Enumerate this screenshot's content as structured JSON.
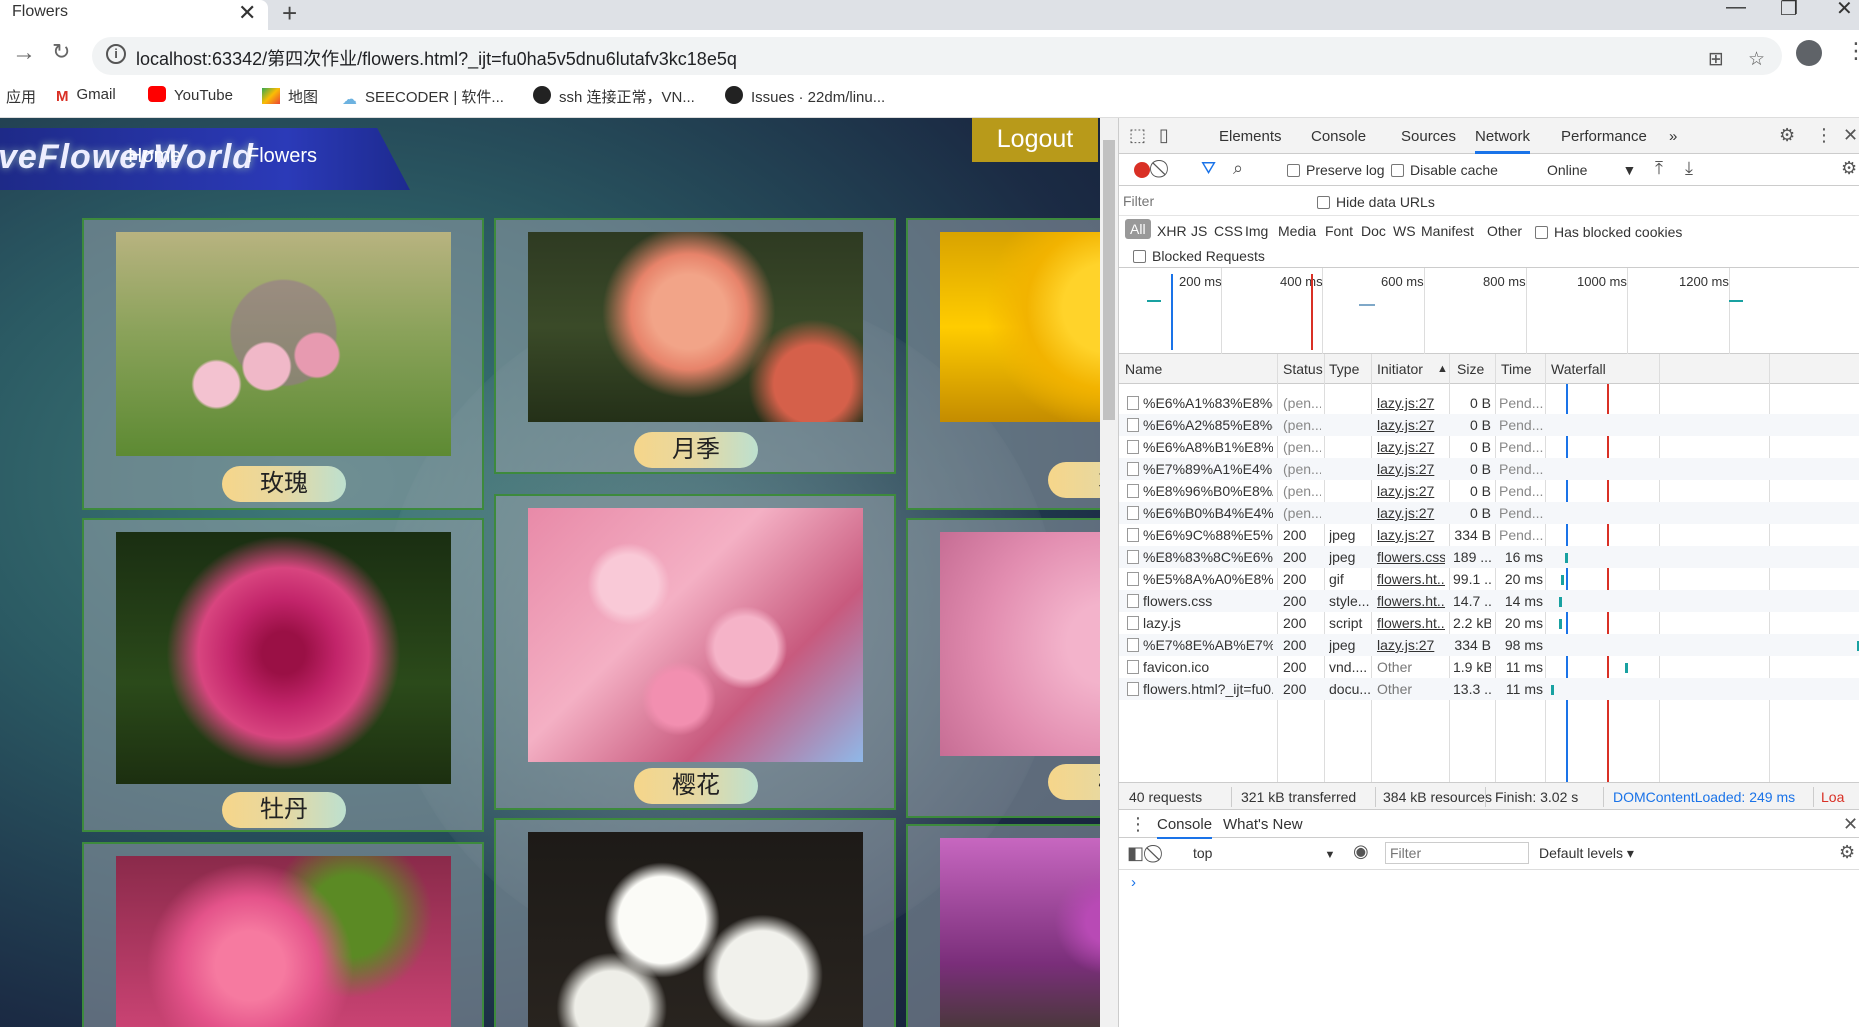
{
  "browser": {
    "tab_title": "Flowers",
    "tab_close": "✕",
    "new_tab": "+",
    "url_prefix": "localhost",
    "url": "localhost:63342/第四次作业/flowers.html?_ijt=fu0ha5v5dnu6lutafv3kc18e5q",
    "window_controls": [
      "—",
      "❐",
      "✕"
    ]
  },
  "bookmarks": [
    {
      "label": "应用",
      "icon": "apps-icon"
    },
    {
      "label": "Gmail",
      "icon": "gmail-icon"
    },
    {
      "label": "YouTube",
      "icon": "youtube-icon"
    },
    {
      "label": "地图",
      "icon": "maps-icon"
    },
    {
      "label": "SEECODER | 软件...",
      "icon": "seecoder-icon"
    },
    {
      "label": "ssh 连接正常，VN...",
      "icon": "github-icon"
    },
    {
      "label": "Issues · 22dm/linu...",
      "icon": "github-icon"
    }
  ],
  "page": {
    "logo": "veFlowerWorld",
    "nav_home": "Home",
    "nav_flowers": "Flowers",
    "logout": "Logout",
    "flowers": [
      "玫瑰",
      "月季",
      "水",
      "牡丹",
      "樱花",
      "梅"
    ]
  },
  "devtools": {
    "tabs": [
      "Elements",
      "Console",
      "Sources",
      "Network",
      "Performance",
      "»"
    ],
    "preserve_log": "Preserve log",
    "disable_cache": "Disable cache",
    "throttle": "Online",
    "filter_placeholder": "Filter",
    "hide_data_urls": "Hide data URLs",
    "types": [
      "All",
      "XHR",
      "JS",
      "CSS",
      "Img",
      "Media",
      "Font",
      "Doc",
      "WS",
      "Manifest",
      "Other"
    ],
    "has_blocked_cookies": "Has blocked cookies",
    "blocked_requests": "Blocked Requests",
    "timeline_labels": [
      "200 ms",
      "400 ms",
      "600 ms",
      "800 ms",
      "1000 ms",
      "1200 ms"
    ],
    "columns": [
      "Name",
      "Status",
      "Type",
      "Initiator",
      "Size",
      "Time",
      "Waterfall"
    ],
    "rows": [
      {
        "name": "%E6%A1%83%E8%8...",
        "status": "(pen...",
        "type": "",
        "initiator": "lazy.js:27",
        "size": "0 B",
        "time": "Pend..."
      },
      {
        "name": "%E6%A2%85%E8%8...",
        "status": "(pen...",
        "type": "",
        "initiator": "lazy.js:27",
        "size": "0 B",
        "time": "Pend..."
      },
      {
        "name": "%E6%A8%B1%E8%8...",
        "status": "(pen...",
        "type": "",
        "initiator": "lazy.js:27",
        "size": "0 B",
        "time": "Pend..."
      },
      {
        "name": "%E7%89%A1%E4%B...",
        "status": "(pen...",
        "type": "",
        "initiator": "lazy.js:27",
        "size": "0 B",
        "time": "Pend..."
      },
      {
        "name": "%E8%96%B0%E8%A...",
        "status": "(pen...",
        "type": "",
        "initiator": "lazy.js:27",
        "size": "0 B",
        "time": "Pend..."
      },
      {
        "name": "%E6%B0%B4%E4%B...",
        "status": "(pen...",
        "type": "",
        "initiator": "lazy.js:27",
        "size": "0 B",
        "time": "Pend..."
      },
      {
        "name": "%E6%9C%88%E5%A...",
        "status": "200",
        "type": "jpeg",
        "initiator": "lazy.js:27",
        "size": "334 B",
        "time": "Pend..."
      },
      {
        "name": "%E8%83%8C%E6%99...",
        "status": "200",
        "type": "jpeg",
        "initiator": "flowers.css",
        "size": "189 ...",
        "time": "16 ms"
      },
      {
        "name": "%E5%8A%A0%E8%B...",
        "status": "200",
        "type": "gif",
        "initiator": "flowers.ht...",
        "size": "99.1 ...",
        "time": "20 ms"
      },
      {
        "name": "flowers.css",
        "status": "200",
        "type": "style...",
        "initiator": "flowers.ht...",
        "size": "14.7 ...",
        "time": "14 ms"
      },
      {
        "name": "lazy.js",
        "status": "200",
        "type": "script",
        "initiator": "flowers.ht...",
        "size": "2.2 kB",
        "time": "20 ms"
      },
      {
        "name": "%E7%8E%AB%E7%91...",
        "status": "200",
        "type": "jpeg",
        "initiator": "lazy.js:27",
        "size": "334 B",
        "time": "98 ms"
      },
      {
        "name": "favicon.ico",
        "status": "200",
        "type": "vnd....",
        "initiator": "Other",
        "size": "1.9 kB",
        "time": "11 ms"
      },
      {
        "name": "flowers.html?_ijt=fu0...",
        "status": "200",
        "type": "docu...",
        "initiator": "Other",
        "size": "13.3 ...",
        "time": "11 ms"
      }
    ],
    "summary": {
      "requests": "40 requests",
      "transferred": "321 kB transferred",
      "resources": "384 kB resources",
      "finish": "Finish: 3.02 s",
      "dom_loaded": "DOMContentLoaded: 249 ms",
      "load": "Loa"
    },
    "drawer_tabs": [
      "Console",
      "What's New"
    ],
    "context": "top",
    "console_filter": "Filter",
    "levels": "Default levels ▾",
    "prompt": "›"
  }
}
